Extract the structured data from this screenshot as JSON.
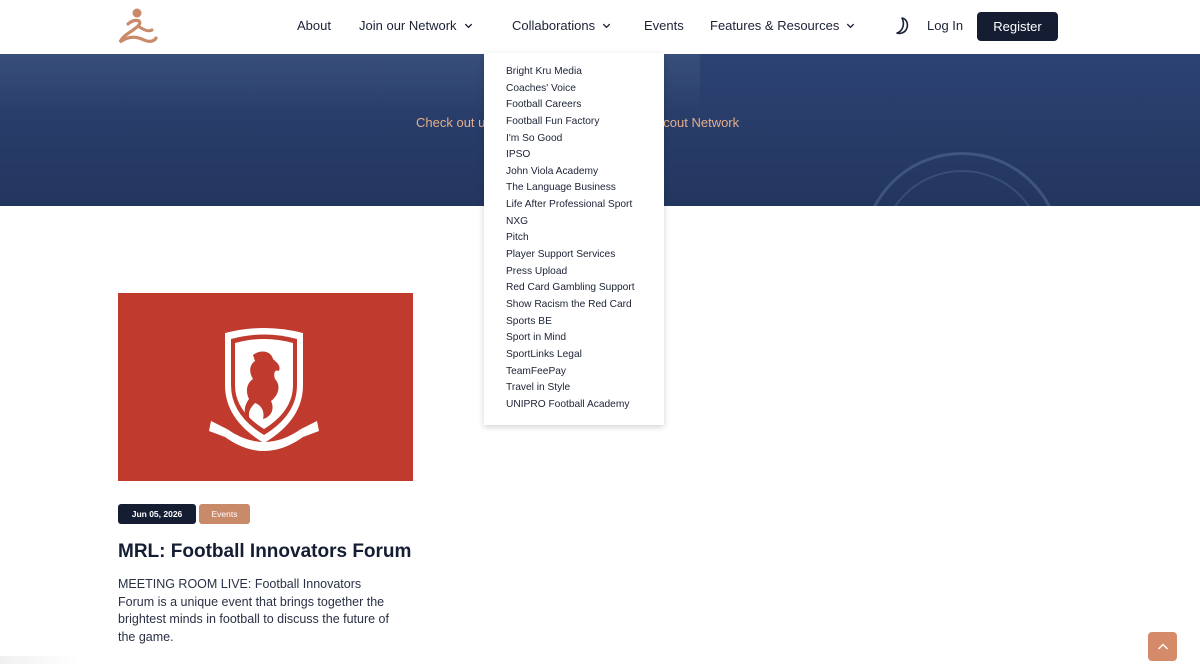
{
  "nav": {
    "items": [
      {
        "label": "About"
      },
      {
        "label": "Join our Network"
      },
      {
        "label": "Collaborations"
      },
      {
        "label": "Events"
      },
      {
        "label": "Features & Resources"
      }
    ],
    "login_label": "Log In",
    "register_label": "Register"
  },
  "hero": {
    "text_left": "Check out u",
    "text_right": "nScout Network"
  },
  "collaborations_menu": [
    "Bright Kru Media",
    "Coaches' Voice",
    "Football Careers",
    "Football Fun Factory",
    "I'm So Good",
    "IPSO",
    "John Viola Academy",
    "The Language Business",
    "Life After Professional Sport",
    "NXG",
    "Pitch",
    "Player Support Services",
    "Press Upload",
    "Red Card Gambling Support",
    "Show Racism the Red Card",
    "Sports BE",
    "Sport in Mind",
    "SportLinks Legal",
    "TeamFeePay",
    "Travel in Style",
    "UNIPRO Football Academy"
  ],
  "card": {
    "date": "Jun 05, 2026",
    "category": "Events",
    "title": "MRL: Football Innovators Forum",
    "description": "MEETING ROOM LIVE: Football Innovators Forum is a unique event that brings together the brightest minds in football to discuss the future of the game."
  },
  "colors": {
    "navy": "#151d33",
    "hero_blue": "#2c4272",
    "accent": "#d58a6a",
    "card_red": "#c03a2e"
  }
}
